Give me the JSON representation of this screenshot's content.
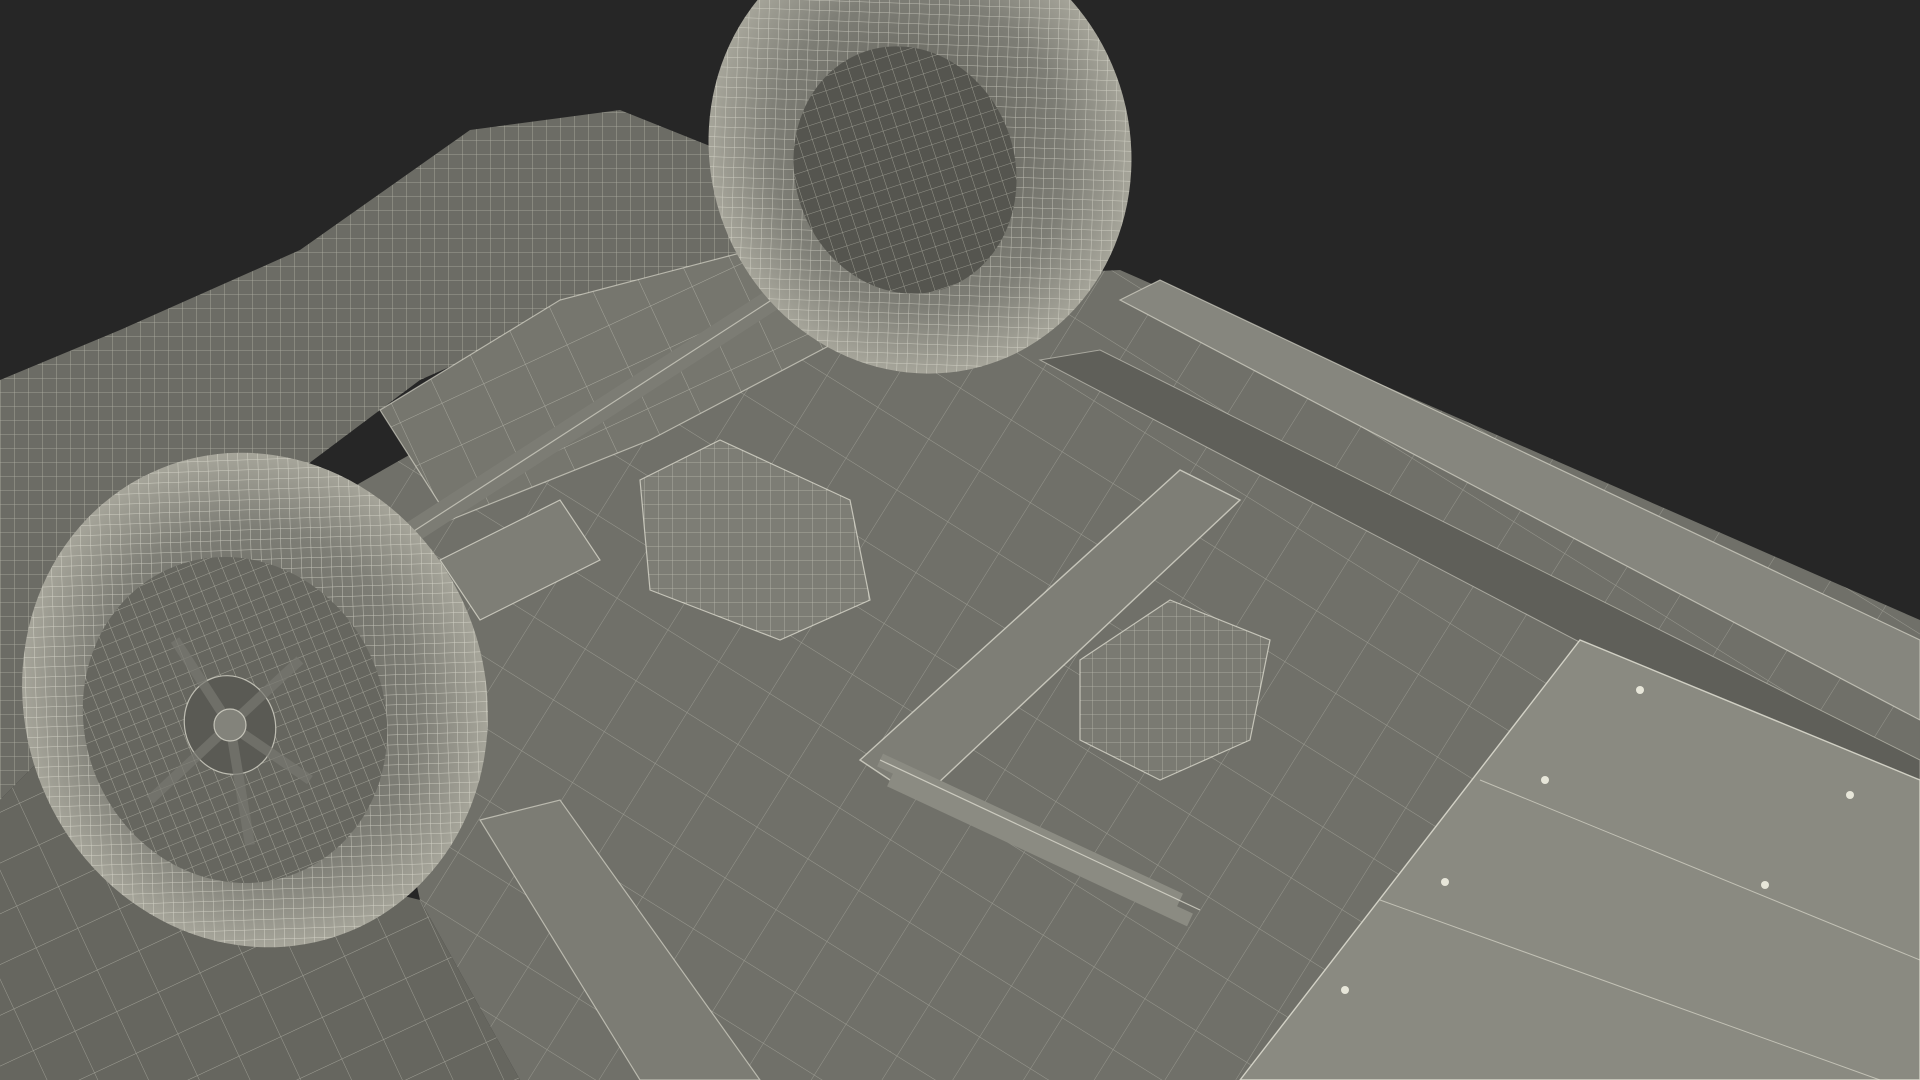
{
  "scene": {
    "subject": "vehicle-underside-wireframe-render",
    "colors": {
      "background": "#262626",
      "body": "#707069",
      "body_light": "#86867e",
      "body_dark": "#56564f",
      "tire": "#8b8b82",
      "tire_light": "#c9c8bc",
      "wire": "#e7e6d9",
      "shadow": "#3c3c38"
    }
  }
}
